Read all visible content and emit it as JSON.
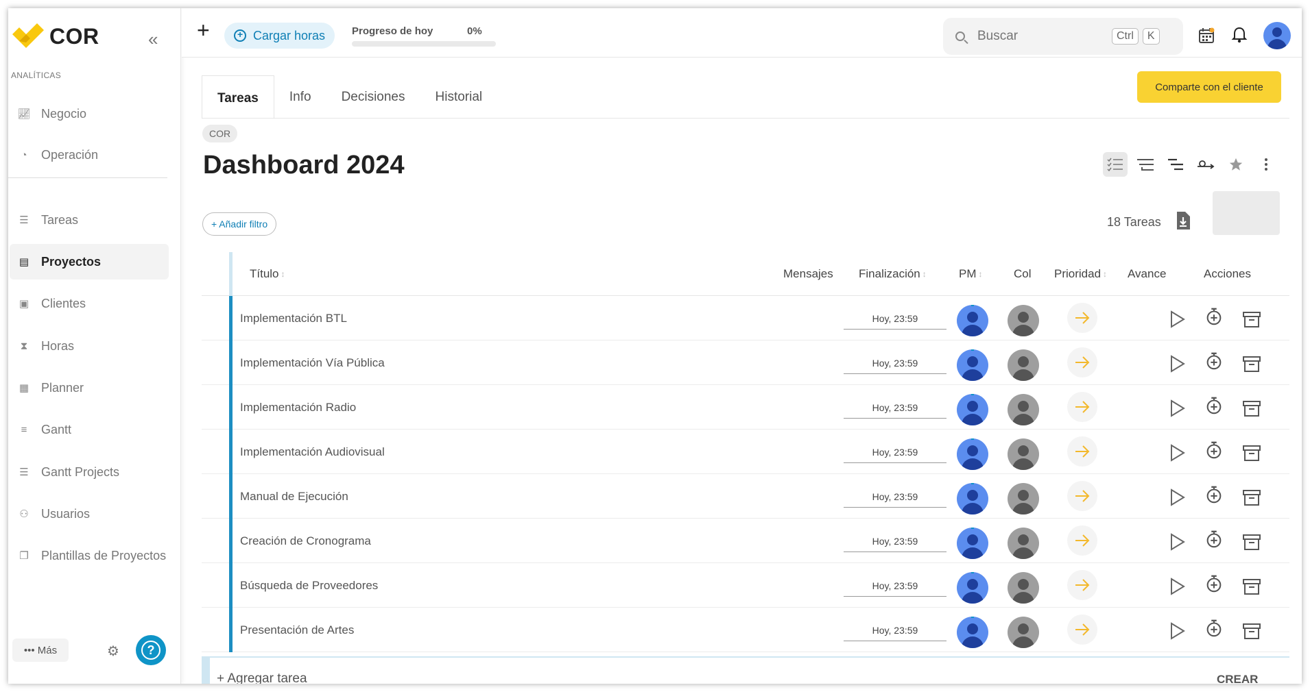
{
  "sidebar": {
    "logo_text": "COR",
    "section_label": "ANALÍTICAS",
    "items": [
      {
        "label": "Negocio",
        "icon": "chart-line-icon"
      },
      {
        "label": "Operación",
        "icon": "pie-chart-icon"
      },
      {
        "label": "Tareas",
        "icon": "task-list-icon"
      },
      {
        "label": "Proyectos",
        "icon": "document-icon",
        "active": true
      },
      {
        "label": "Clientes",
        "icon": "contact-card-icon"
      },
      {
        "label": "Horas",
        "icon": "hourglass-icon"
      },
      {
        "label": "Planner",
        "icon": "calendar-icon"
      },
      {
        "label": "Gantt",
        "icon": "gantt-icon"
      },
      {
        "label": "Gantt Projects",
        "icon": "gantt-projects-icon"
      },
      {
        "label": "Usuarios",
        "icon": "users-icon"
      },
      {
        "label": "Plantillas de Proyectos",
        "icon": "copy-icon"
      }
    ],
    "more_label": "••• Más"
  },
  "topbar": {
    "cargar_label": "Cargar horas",
    "progress_label": "Progreso de hoy",
    "progress_pct": "0%",
    "progress_value": 0,
    "search_placeholder": "Buscar",
    "kbd_ctrl": "Ctrl",
    "kbd_k": "K"
  },
  "tabs": [
    "Tareas",
    "Info",
    "Decisiones",
    "Historial"
  ],
  "share_label": "Comparte con el cliente",
  "breadcrumb": "COR",
  "page_title": "Dashboard 2024",
  "filter_label": "+ Añadir filtro",
  "task_count": "18 Tareas",
  "table": {
    "headers": {
      "titulo": "Título",
      "mensajes": "Mensajes",
      "finalizacion": "Finalización",
      "pm": "PM",
      "col": "Col",
      "prioridad": "Prioridad",
      "avance": "Avance",
      "acciones": "Acciones"
    },
    "rows": [
      {
        "title": "Implementación BTL",
        "date": "Hoy, 23:59"
      },
      {
        "title": "Implementación Vía Pública",
        "date": "Hoy, 23:59"
      },
      {
        "title": "Implementación Radio",
        "date": "Hoy, 23:59"
      },
      {
        "title": "Implementación Audiovisual",
        "date": "Hoy, 23:59"
      },
      {
        "title": "Manual de Ejecución",
        "date": "Hoy, 23:59"
      },
      {
        "title": "Creación de Cronograma",
        "date": "Hoy, 23:59"
      },
      {
        "title": "Búsqueda de Proveedores",
        "date": "Hoy, 23:59"
      },
      {
        "title": "Presentación de Artes",
        "date": "Hoy, 23:59"
      }
    ]
  },
  "add_task_label": "+ Agregar tarea",
  "create_label": "CREAR",
  "colors": {
    "accent_blue": "#0f94c7",
    "share_yellow": "#f9d232",
    "priority_arrow": "#f3b82c"
  }
}
